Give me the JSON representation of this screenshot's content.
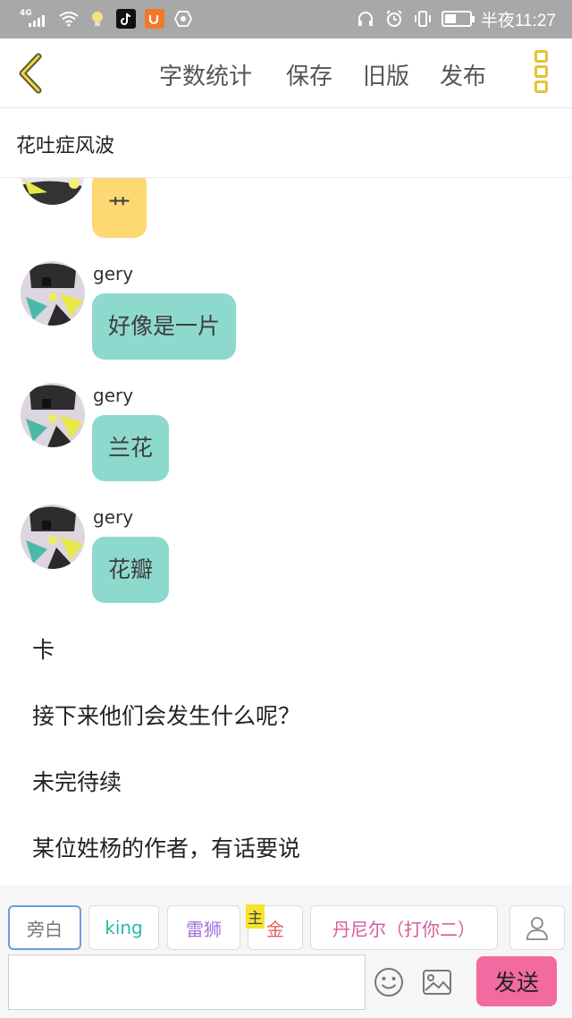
{
  "status_bar": {
    "network": "4G",
    "time": "半夜11:27",
    "battery_percent": 45,
    "icons": [
      "signal-icon",
      "wifi-icon",
      "bulb-icon",
      "tiktok-icon",
      "uc-browser-icon",
      "camera-icon",
      "headphones-icon",
      "alarm-icon",
      "vibrate-icon",
      "battery-icon"
    ]
  },
  "toolbar": {
    "word_count": "字数统计",
    "save": "保存",
    "old_version": "旧版",
    "publish": "发布"
  },
  "story": {
    "title": "花吐症风波"
  },
  "chat": {
    "partial_message": {
      "text": "艹"
    },
    "messages": [
      {
        "sender": "gery",
        "text": "好像是一片"
      },
      {
        "sender": "gery",
        "text": "兰花"
      },
      {
        "sender": "gery",
        "text": "花瓣"
      }
    ],
    "narrations": [
      "卡",
      "接下来他们会发生什么呢？",
      "未完待续",
      "某位姓杨的作者，有话要说"
    ]
  },
  "roles": [
    {
      "label": "旁白",
      "color": "#777777"
    },
    {
      "label": "king",
      "color": "#2bb5a4"
    },
    {
      "label": "雷狮",
      "color": "#a66fd6"
    },
    {
      "label": "金",
      "color": "#e06262",
      "tag": "主"
    },
    {
      "label": "丹尼尔（打你二）",
      "color": "#d65c99"
    }
  ],
  "composer": {
    "input_value": "",
    "send": "发送"
  },
  "colors": {
    "accent_yellow": "#e3c33a",
    "bubble_teal": "#8ed9ce",
    "bubble_yellow": "#fdd873",
    "send_pink": "#f36aa0"
  }
}
